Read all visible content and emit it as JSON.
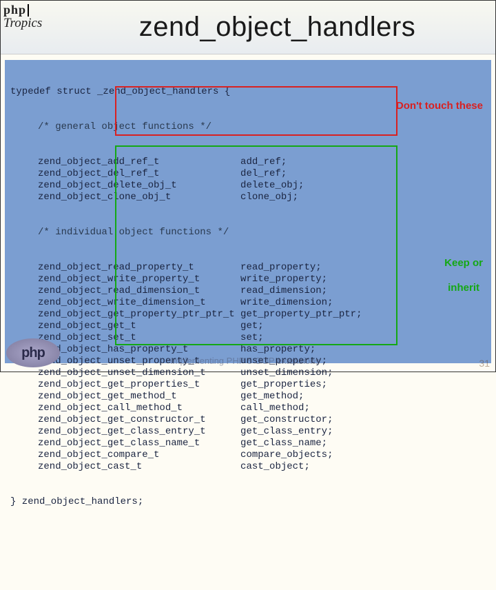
{
  "header": {
    "logo_top": "php",
    "logo_bottom": "Tropics",
    "title": "zend_object_handlers"
  },
  "code": {
    "open": "typedef struct _zend_object_handlers {",
    "comment1": "/* general object functions */",
    "group1": [
      {
        "type": "zend_object_add_ref_t",
        "name": "add_ref;"
      },
      {
        "type": "zend_object_del_ref_t",
        "name": "del_ref;"
      },
      {
        "type": "zend_object_delete_obj_t",
        "name": "delete_obj;"
      },
      {
        "type": "zend_object_clone_obj_t",
        "name": "clone_obj;"
      }
    ],
    "comment2": "/* individual object functions */",
    "group2": [
      {
        "type": "zend_object_read_property_t",
        "name": "read_property;"
      },
      {
        "type": "zend_object_write_property_t",
        "name": "write_property;"
      },
      {
        "type": "zend_object_read_dimension_t",
        "name": "read_dimension;"
      },
      {
        "type": "zend_object_write_dimension_t",
        "name": "write_dimension;"
      },
      {
        "type": "zend_object_get_property_ptr_ptr_t",
        "name": "get_property_ptr_ptr;"
      },
      {
        "type": "zend_object_get_t",
        "name": "get;"
      },
      {
        "type": "zend_object_set_t",
        "name": "set;"
      },
      {
        "type": "zend_object_has_property_t",
        "name": "has_property;"
      },
      {
        "type": "zend_object_unset_property_t",
        "name": "unset_property;"
      },
      {
        "type": "zend_object_unset_dimension_t",
        "name": "unset_dimension;"
      },
      {
        "type": "zend_object_get_properties_t",
        "name": "get_properties;"
      },
      {
        "type": "zend_object_get_method_t",
        "name": "get_method;"
      },
      {
        "type": "zend_object_call_method_t",
        "name": "call_method;"
      },
      {
        "type": "zend_object_get_constructor_t",
        "name": "get_constructor;"
      },
      {
        "type": "zend_object_get_class_entry_t",
        "name": "get_class_entry;"
      },
      {
        "type": "zend_object_get_class_name_t",
        "name": "get_class_name;"
      },
      {
        "type": "zend_object_compare_t",
        "name": "compare_objects;"
      },
      {
        "type": "zend_object_cast_t",
        "name": "cast_object;"
      }
    ],
    "close": "} zend_object_handlers;"
  },
  "annotations": {
    "red": "Don't touch these",
    "green_line1": "Keep or",
    "green_line2": "inherit"
  },
  "footer": {
    "php_logo": "php",
    "watermark": "Implementing PHP 5 OOP extensions",
    "pagenum": "31"
  }
}
